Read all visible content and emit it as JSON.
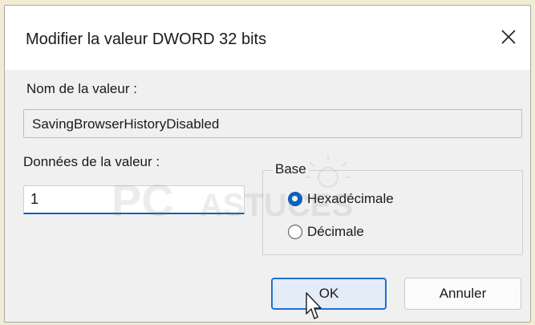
{
  "dialog": {
    "title": "Modifier la valeur DWORD 32 bits",
    "close_icon": "close-icon"
  },
  "name_field": {
    "label": "Nom de la valeur :",
    "value": "SavingBrowserHistoryDisabled"
  },
  "data_field": {
    "label": "Données de la valeur :",
    "value": "1"
  },
  "base": {
    "legend": "Base",
    "options": [
      {
        "label": "Hexadécimale",
        "checked": true
      },
      {
        "label": "Décimale",
        "checked": false
      }
    ]
  },
  "buttons": {
    "ok_label": "OK",
    "cancel_label": "Annuler"
  },
  "watermark": {
    "brand_left": "PC",
    "brand_right": "ASTUCES"
  },
  "colors": {
    "accent": "#0a5fbf",
    "dialog_bg": "#f0f0f0",
    "title_bg": "#ffffff"
  }
}
